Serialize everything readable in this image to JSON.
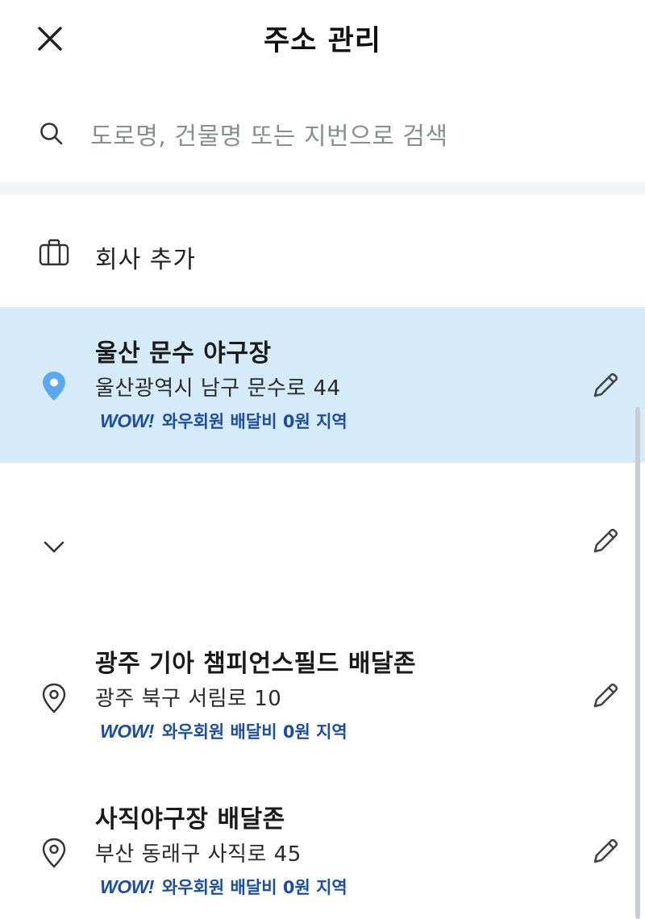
{
  "header": {
    "title": "주소 관리",
    "close_icon": "close-icon"
  },
  "search": {
    "placeholder": "도로명, 건물명 또는 지번으로 검색",
    "icon": "search-icon"
  },
  "company": {
    "label": "회사 추가",
    "icon": "briefcase-icon"
  },
  "addresses": [
    {
      "name": "울산 문수 야구장",
      "address": "울산광역시 남구 문수로 44",
      "wow_logo": "WOW!",
      "wow_text": "와우회원 배달비 0원 지역",
      "selected": true
    },
    {
      "name": "광주 기아 챔피언스필드 배달존",
      "address": "광주 북구 서림로 10",
      "wow_logo": "WOW!",
      "wow_text": "와우회원 배달비 0원 지역",
      "selected": false
    },
    {
      "name": "사직야구장 배달존",
      "address": "부산 동래구 사직로 45",
      "wow_logo": "WOW!",
      "wow_text": "와우회원 배달비 0원 지역",
      "selected": false
    }
  ],
  "colors": {
    "accent": "#5aa9f0",
    "selected_bg": "#d5ebfa",
    "wow": "#1d4e9e",
    "placeholder": "#8a8d91"
  }
}
